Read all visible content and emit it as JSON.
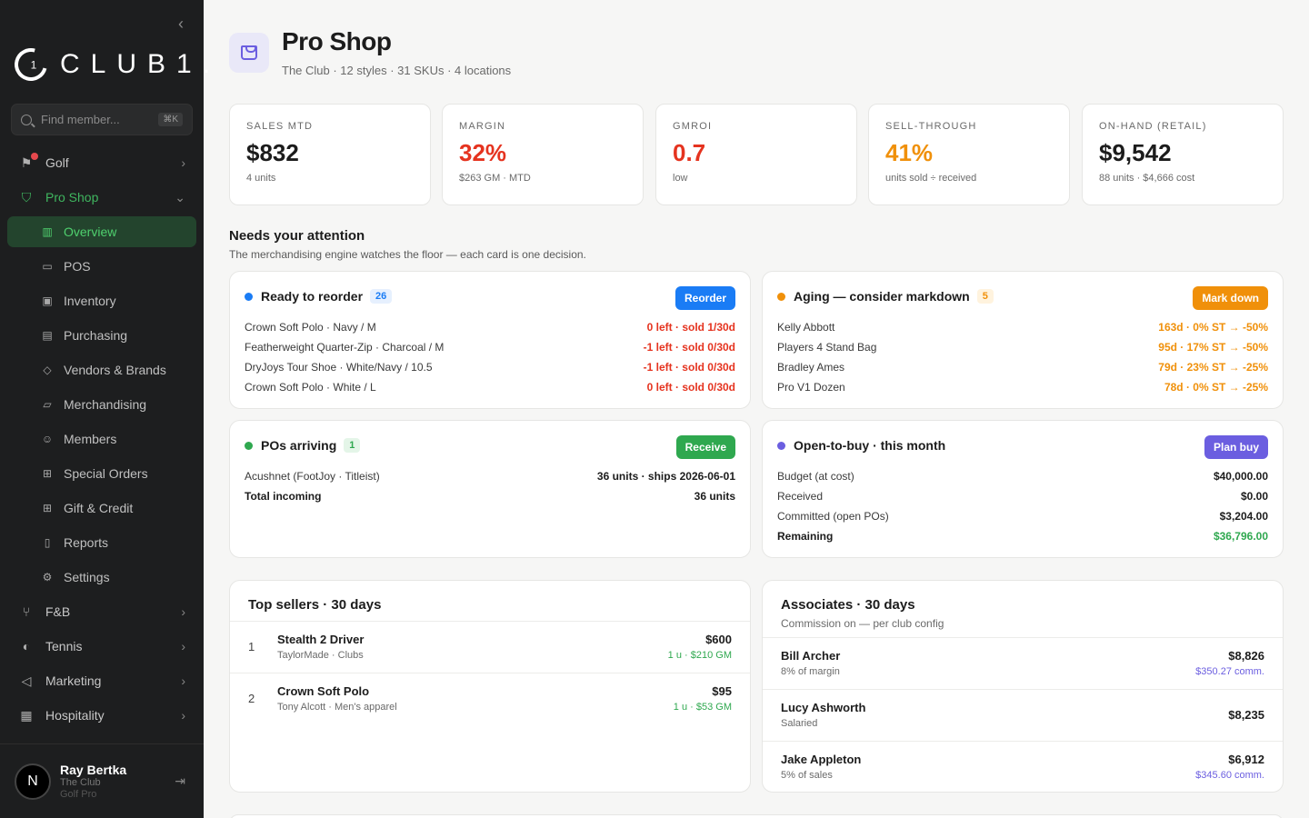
{
  "sidebar": {
    "collapse_icon": "chevron-left-icon",
    "brand": "CLUB1.",
    "brand_mark": "1",
    "search_placeholder": "Find member...",
    "search_shortcut": "⌘K",
    "nav": [
      {
        "label": "Golf",
        "icon": "flag-icon"
      },
      {
        "label": "Pro Shop",
        "icon": "bag-icon"
      },
      {
        "label": "F&B",
        "icon": "utensils-icon"
      },
      {
        "label": "Tennis",
        "icon": "tennis-icon"
      },
      {
        "label": "Marketing",
        "icon": "megaphone-icon"
      },
      {
        "label": "Hospitality",
        "icon": "building-icon"
      }
    ],
    "sub": [
      {
        "label": "Overview",
        "icon": "chart-icon"
      },
      {
        "label": "POS",
        "icon": "card-icon"
      },
      {
        "label": "Inventory",
        "icon": "box-icon"
      },
      {
        "label": "Purchasing",
        "icon": "doc-icon"
      },
      {
        "label": "Vendors & Brands",
        "icon": "tag-icon"
      },
      {
        "label": "Merchandising",
        "icon": "presentation-icon"
      },
      {
        "label": "Members",
        "icon": "users-icon"
      },
      {
        "label": "Special Orders",
        "icon": "gift-icon"
      },
      {
        "label": "Gift & Credit",
        "icon": "gift-icon"
      },
      {
        "label": "Reports",
        "icon": "file-icon"
      },
      {
        "label": "Settings",
        "icon": "gear-icon"
      }
    ],
    "user": {
      "initial": "N",
      "name": "Ray Bertka",
      "club": "The Club",
      "role": "Golf Pro"
    }
  },
  "header": {
    "title": "Pro Shop",
    "subtitle": "The Club · 12 styles · 31 SKUs · 4 locations"
  },
  "kpis": [
    {
      "label": "SALES MTD",
      "value": "$832",
      "sub": "4 units",
      "color": "#1c1c1c"
    },
    {
      "label": "MARGIN",
      "value": "32%",
      "sub": "$263 GM · MTD",
      "color": "#e5331f"
    },
    {
      "label": "GMROI",
      "value": "0.7",
      "sub": "low",
      "color": "#e5331f"
    },
    {
      "label": "SELL-THROUGH",
      "value": "41%",
      "sub": "units sold ÷ received",
      "color": "#f0900a"
    },
    {
      "label": "ON-HAND (RETAIL)",
      "value": "$9,542",
      "sub": "88 units · $4,666 cost",
      "color": "#1c1c1c"
    }
  ],
  "attention": {
    "title": "Needs your attention",
    "subtitle": "The merchandising engine watches the floor — each card is one decision."
  },
  "reorder": {
    "title": "Ready to reorder",
    "count": "26",
    "button": "Reorder",
    "rows": [
      {
        "name": "Crown Soft Polo · Navy / M",
        "value": "0 left · sold 1/30d"
      },
      {
        "name": "Featherweight Quarter-Zip · Charcoal / M",
        "value": "-1 left · sold 0/30d"
      },
      {
        "name": "DryJoys Tour Shoe · White/Navy / 10.5",
        "value": "-1 left · sold 0/30d"
      },
      {
        "name": "Crown Soft Polo · White / L",
        "value": "0 left · sold 0/30d"
      }
    ]
  },
  "aging": {
    "title": "Aging — consider markdown",
    "count": "5",
    "button": "Mark down",
    "rows": [
      {
        "name": "Kelly Abbott",
        "value": "163d · 0% ST → -50%"
      },
      {
        "name": "Players 4 Stand Bag",
        "value": "95d · 17% ST → -50%"
      },
      {
        "name": "Bradley Ames",
        "value": "79d · 23% ST → -25%"
      },
      {
        "name": "Pro V1 Dozen",
        "value": "78d · 0% ST → -25%"
      }
    ]
  },
  "pos": {
    "title": "POs arriving",
    "count": "1",
    "button": "Receive",
    "rows": [
      {
        "name": "Acushnet (FootJoy · Titleist)",
        "value": "36 units · ships 2026-06-01"
      },
      {
        "name": "Total incoming",
        "value": "36 units"
      }
    ]
  },
  "otb": {
    "title": "Open-to-buy · this month",
    "button": "Plan buy",
    "rows": [
      {
        "name": "Budget (at cost)",
        "value": "$40,000.00"
      },
      {
        "name": "Received",
        "value": "$0.00"
      },
      {
        "name": "Committed (open POs)",
        "value": "$3,204.00"
      },
      {
        "name": "Remaining",
        "value": "$36,796.00"
      }
    ]
  },
  "top_sellers": {
    "title": "Top sellers · 30 days",
    "items": [
      {
        "rank": "1",
        "name": "Stealth 2 Driver",
        "sub": "TaylorMade · Clubs",
        "value": "$600",
        "detail": "1 u · $210 GM"
      },
      {
        "rank": "2",
        "name": "Crown Soft Polo",
        "sub": "Tony Alcott · Men's apparel",
        "value": "$95",
        "detail": "1 u · $53 GM"
      }
    ]
  },
  "associates": {
    "title": "Associates · 30 days",
    "subtitle": "Commission on — per club config",
    "items": [
      {
        "name": "Bill Archer",
        "sub": "8% of margin",
        "value": "$8,826",
        "detail": "$350.27 comm."
      },
      {
        "name": "Lucy Ashworth",
        "sub": "Salaried",
        "value": "$8,235",
        "detail": ""
      },
      {
        "name": "Jake Appleton",
        "sub": "5% of sales",
        "value": "$6,912",
        "detail": "$345.60 comm."
      }
    ]
  },
  "colors": {
    "blue": "#1a7cf5",
    "orange": "#f0900a",
    "green": "#2fa84f",
    "purple": "#6b5ee0",
    "red": "#e5331f"
  }
}
